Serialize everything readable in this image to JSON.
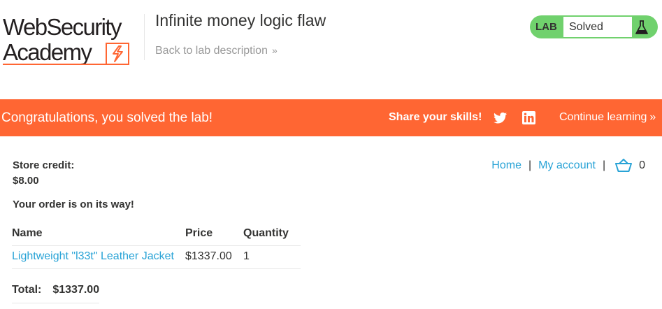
{
  "logo": {
    "line1": "WebSecurity",
    "line2": "Academy",
    "accent_color": "#ff6633"
  },
  "header": {
    "lab_title": "Infinite money logic flaw",
    "back_link": "Back to lab description",
    "lab_badge": "LAB",
    "lab_status": "Solved",
    "status_color": "#70d16d",
    "flask_icon": "flask-icon"
  },
  "banner": {
    "message": "Congratulations, you solved the lab!",
    "share_label": "Share your skills!",
    "continue_label": "Continue learning",
    "background": "#ff6633",
    "icons": [
      "twitter-icon",
      "linkedin-icon"
    ]
  },
  "nav": {
    "home": "Home",
    "separator": "|",
    "my_account": "My account",
    "cart_count": "0",
    "link_color": "#29a3d6"
  },
  "account": {
    "store_credit_label": "Store credit:",
    "store_credit_value": "$8.00",
    "order_message": "Your order is on its way!"
  },
  "order_table": {
    "headers": {
      "name": "Name",
      "price": "Price",
      "quantity": "Quantity"
    },
    "rows": [
      {
        "name": "Lightweight \"l33t\" Leather Jacket",
        "price": "$1337.00",
        "quantity": "1"
      }
    ]
  },
  "total": {
    "label": "Total:",
    "value": "$1337.00"
  }
}
